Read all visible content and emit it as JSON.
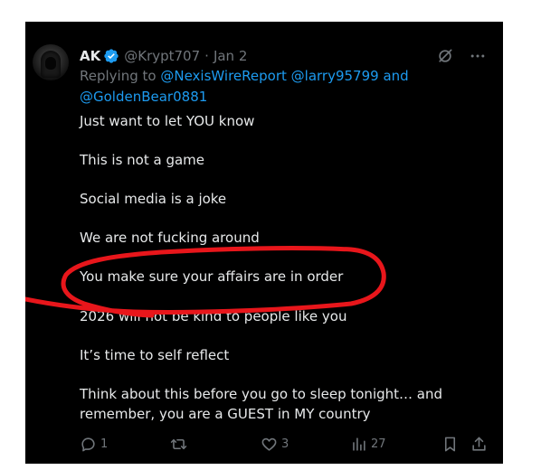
{
  "tweet": {
    "author": {
      "display_name": "AK",
      "handle": "@Krypt707",
      "separator": "·",
      "date": "Jan 2",
      "verified_color": "#1d9bf0"
    },
    "replying_to": {
      "prefix": "Replying to",
      "mentions": [
        "@NexisWireReport",
        "@larry95799",
        "@GoldenBear0881"
      ],
      "joiner": "and"
    },
    "paragraphs": [
      "Just want to let YOU know",
      "This is not a game",
      "Social media is a joke",
      "We are not fucking around",
      "You make sure your affairs are in order",
      "2026 will not be kind to people like you",
      "It’s time to self reflect",
      "Think about this before you go to sleep tonight… and",
      "remember, you are a GUEST in MY country"
    ],
    "actions": {
      "replies": "1",
      "retweets": "",
      "likes": "3",
      "views": "27"
    },
    "icons": [
      "grok-icon",
      "more-icon",
      "reply-icon",
      "retweet-icon",
      "like-icon",
      "views-icon",
      "bookmark-icon",
      "share-icon"
    ],
    "annotation_color": "#e8161b",
    "text_color": "#e7e9ea",
    "muted_color": "#71767b",
    "link_color": "#1d9bf0"
  }
}
